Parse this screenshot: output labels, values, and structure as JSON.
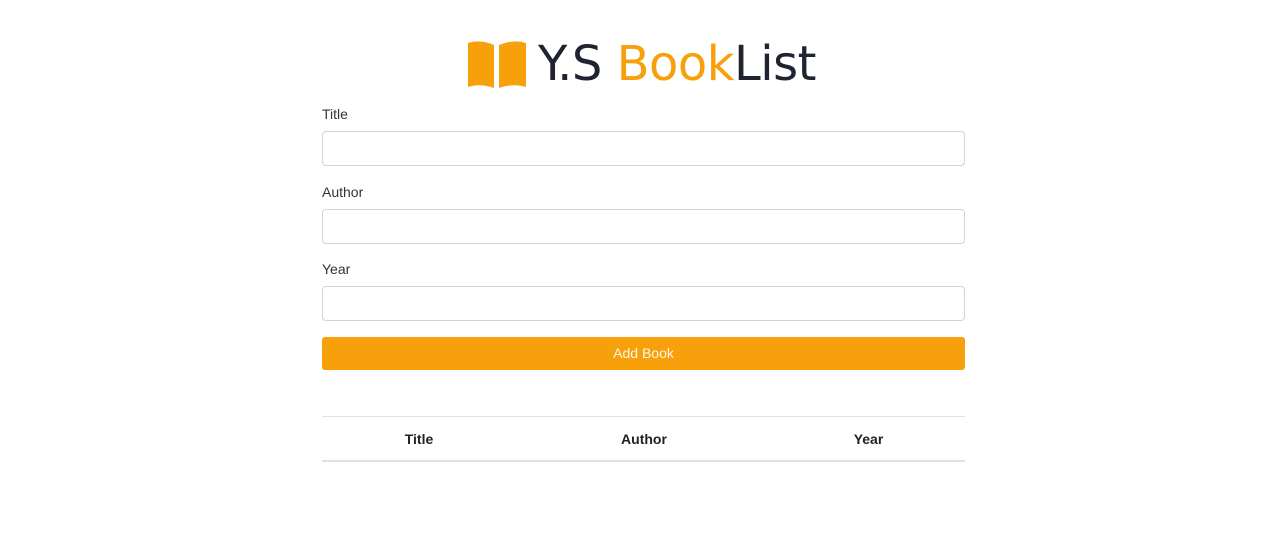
{
  "brand": {
    "part1": "Y.S ",
    "part2": "Book",
    "part3": "List",
    "icon": "open-book-icon",
    "accent_color": "#f8a00b",
    "dark_color": "#1f2430"
  },
  "form": {
    "title_label": "Title",
    "title_value": "",
    "author_label": "Author",
    "author_value": "",
    "year_label": "Year",
    "year_value": "",
    "submit_label": "Add Book"
  },
  "table": {
    "columns": [
      "Title",
      "Author",
      "Year"
    ],
    "rows": []
  }
}
